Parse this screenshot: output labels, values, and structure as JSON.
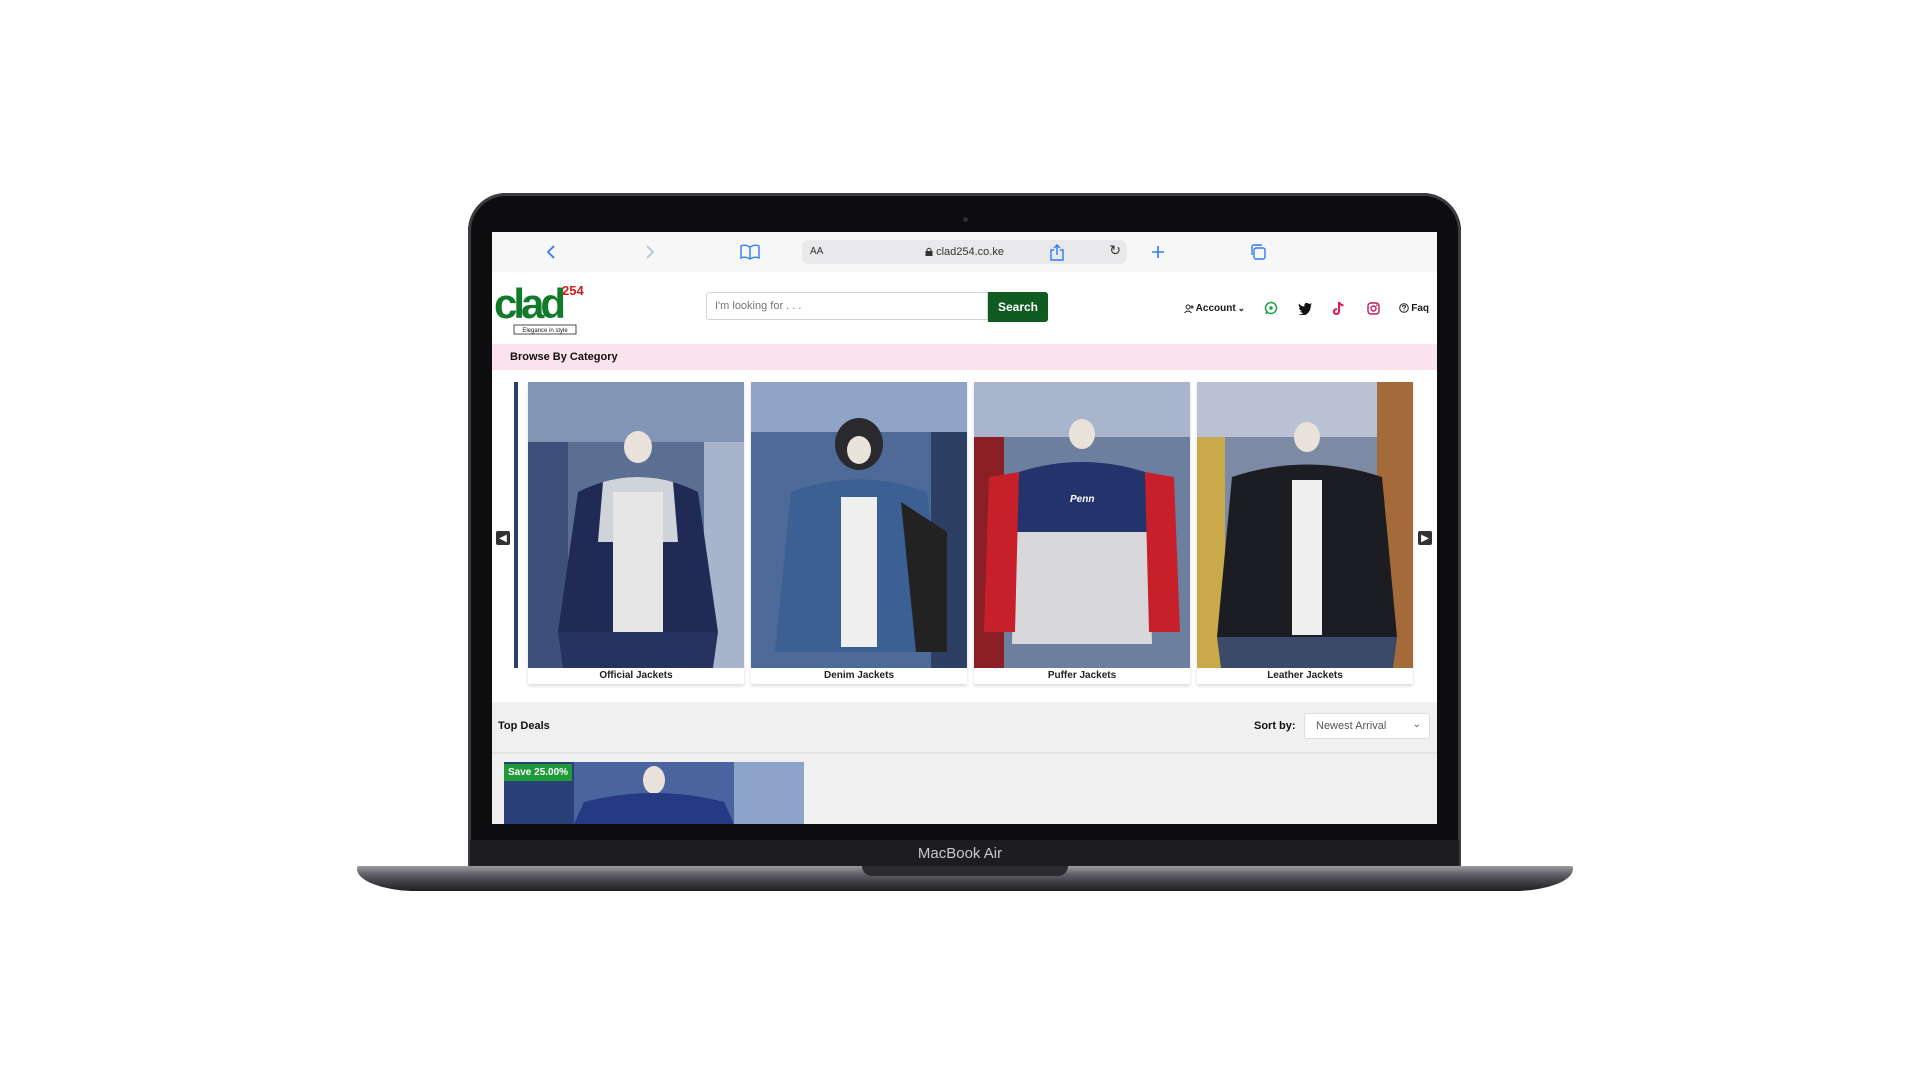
{
  "device": {
    "label": "MacBook Air"
  },
  "browser": {
    "url": "clad254.co.ke",
    "text_size_label": "AA"
  },
  "site": {
    "logo_text": "clad",
    "logo_superscript": "254",
    "logo_tagline": "Elegance in style",
    "search": {
      "placeholder": "I'm looking for . . .",
      "button_label": "Search"
    },
    "account_label": "Account",
    "faq_label": "Faq",
    "socials": [
      "whatsapp-icon",
      "twitter-icon",
      "tiktok-icon",
      "instagram-icon"
    ]
  },
  "categories": {
    "title": "Browse By Category",
    "items": [
      {
        "label": "Official Jackets"
      },
      {
        "label": "Denim Jackets"
      },
      {
        "label": "Puffer Jackets"
      },
      {
        "label": "Leather Jackets"
      }
    ]
  },
  "deals": {
    "title": "Top Deals",
    "sort_label": "Sort by:",
    "sort_value": "Newest Arrival",
    "badge": "Save 25.00%"
  },
  "colors": {
    "search_button": "#0f5b21",
    "category_band": "#fbe3ee",
    "save_badge": "#1e9a3a",
    "safari_accent": "#2f7cf6"
  }
}
